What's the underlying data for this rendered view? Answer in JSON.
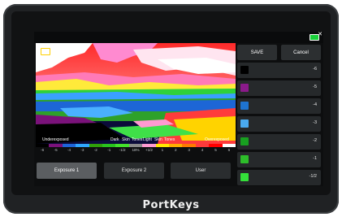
{
  "toolbar": {
    "save_label": "SAVE",
    "cancel_label": "Cancel"
  },
  "scale": {
    "underexposed": "Underexposed",
    "dark_skin": "Dark",
    "skin": "Skin",
    "tones": "Tones",
    "light": "Light",
    "light_skin": "Skin",
    "light_tones": "Tones",
    "overexposed": "Overexposed",
    "stops": [
      "-6",
      "-5",
      "-4",
      "-3",
      "-2",
      "-1",
      "-1/2",
      "18%",
      "+1/2",
      "1",
      "2",
      "3",
      "4",
      "5",
      "6"
    ],
    "colors": [
      "#000000",
      "#7a127a",
      "#1e64d8",
      "#2fa6ff",
      "#2fa00a",
      "#29c21e",
      "#44e02c",
      "#8a8a8a",
      "#ff9ad1",
      "#ffe800",
      "#ffb000",
      "#ff7a00",
      "#ff3a3a",
      "#ff0000",
      "#ffffff"
    ]
  },
  "modes": [
    "Exposure 1",
    "Exposure 2",
    "User"
  ],
  "exposure_rows": [
    {
      "value": "-6",
      "color": "#000000"
    },
    {
      "value": "-5",
      "color": "#8a1a8a"
    },
    {
      "value": "-4",
      "color": "#1e73d0"
    },
    {
      "value": "-3",
      "color": "#4aaaf0"
    },
    {
      "value": "-2",
      "color": "#18a020"
    },
    {
      "value": "-1",
      "color": "#2dbd2a"
    },
    {
      "value": "-1/2",
      "color": "#34e03a"
    }
  ],
  "brand": {
    "logo": "PortKeys"
  }
}
